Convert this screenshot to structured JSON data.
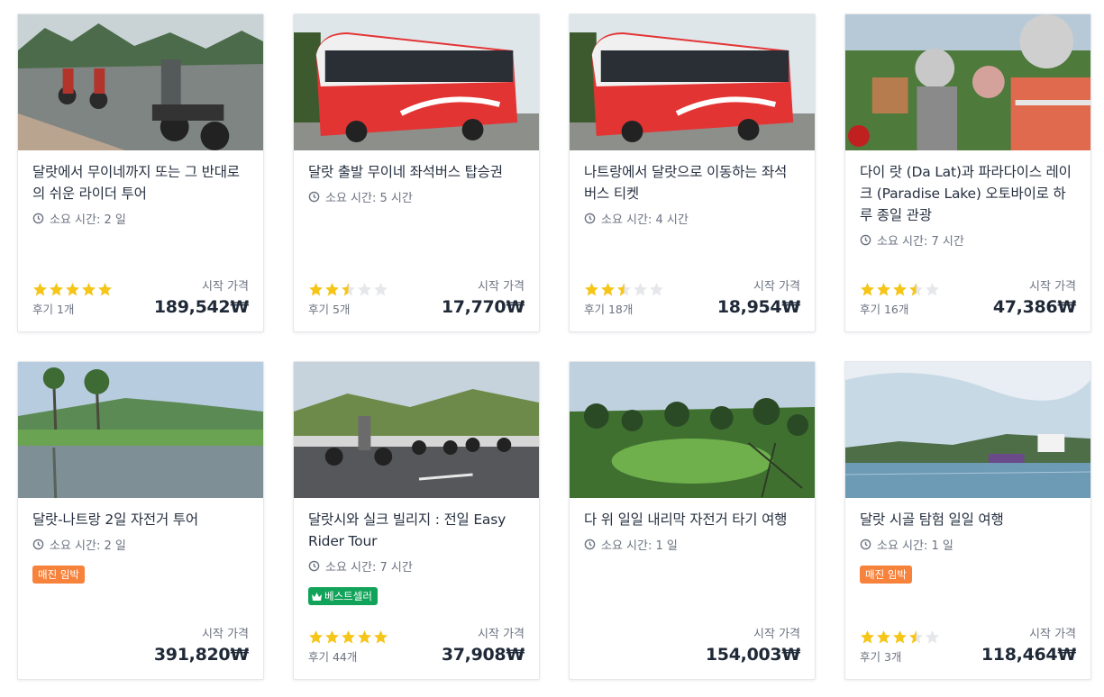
{
  "cards": [
    {
      "title": "달랏에서 무이네까지 또는 그 반대로의 쉬운 라이더 투어",
      "duration": "소요 시간: 2 일",
      "rating": 5,
      "reviews": "후기 1개",
      "price_label": "시작 가격",
      "price": "189,542₩",
      "image": "motorcycle-riders-road"
    },
    {
      "title": "달랏 출발 무이네 좌석버스 탑승권",
      "duration": "소요 시간: 5 시간",
      "rating": 2.5,
      "reviews": "후기 5개",
      "price_label": "시작 가격",
      "price": "17,770₩",
      "image": "red-bus"
    },
    {
      "title": "나트랑에서 달랏으로 이동하는 좌석 버스 티켓",
      "duration": "소요 시간: 4 시간",
      "rating": 2.5,
      "reviews": "후기 18개",
      "price_label": "시작 가격",
      "price": "18,954₩",
      "image": "red-bus"
    },
    {
      "title": "다이 랏 (Da Lat)과 파라다이스 레이크 (Paradise Lake) 오토바이로 하루 종일 관광",
      "duration": "소요 시간: 7 시간",
      "rating": 3.5,
      "reviews": "후기 16개",
      "price_label": "시작 가격",
      "price": "47,386₩",
      "image": "helmet-selfie"
    },
    {
      "title": "달랏-나트랑 2일 자전거 투어",
      "duration": "소요 시간: 2 일",
      "badge": "매진 임박",
      "badge_color": "#f7823b",
      "price_label": "시작 가격",
      "price": "391,820₩",
      "image": "lake-palms"
    },
    {
      "title": "달랏시와 실크 빌리지 : 전일 Easy Rider Tour",
      "duration": "소요 시간: 7 시간",
      "badge": "베스트셀러",
      "badge_color": "#12a35a",
      "rating": 5,
      "reviews": "후기 44개",
      "price_label": "시작 가격",
      "price": "37,908₩",
      "image": "motorcycles-hills"
    },
    {
      "title": "다 위 일일 내리막 자전거 타기 여행",
      "duration": "소요 시간: 1 일",
      "price_label": "시작 가격",
      "price": "154,003₩",
      "image": "pine-golf"
    },
    {
      "title": "달랏 시골 탐험 일일 여행",
      "duration": "소요 시간: 1 일",
      "badge": "매진 임박",
      "badge_color": "#f7823b",
      "rating": 3.5,
      "reviews": "후기 3개",
      "price_label": "시작 가격",
      "price": "118,464₩",
      "image": "city-lake"
    }
  ],
  "colors": {
    "star": "#f5c518",
    "star_empty": "#e5e7eb",
    "orange": "#f7823b",
    "green": "#12a35a"
  },
  "icons": {
    "clock": "clock-icon",
    "star": "star-icon",
    "crown": "crown-icon"
  }
}
